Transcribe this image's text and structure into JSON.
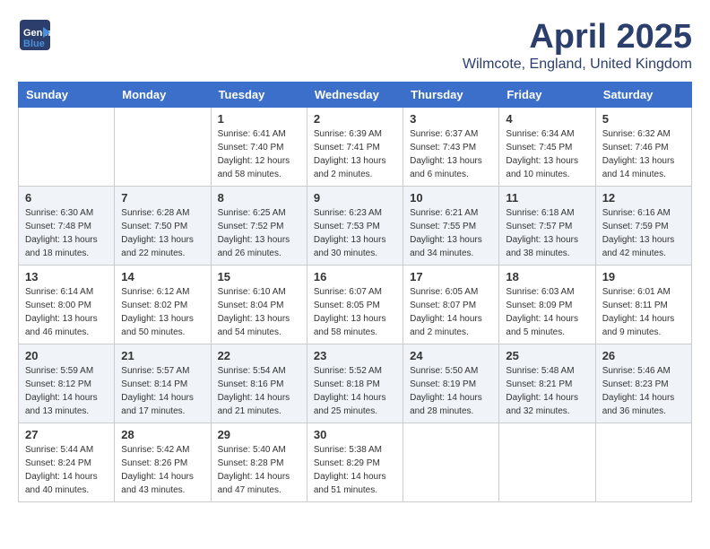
{
  "header": {
    "logo_general": "General",
    "logo_blue": "Blue",
    "month_title": "April 2025",
    "location": "Wilmcote, England, United Kingdom"
  },
  "days_of_week": [
    "Sunday",
    "Monday",
    "Tuesday",
    "Wednesday",
    "Thursday",
    "Friday",
    "Saturday"
  ],
  "weeks": [
    [
      {
        "day": "",
        "info": ""
      },
      {
        "day": "",
        "info": ""
      },
      {
        "day": "1",
        "info": "Sunrise: 6:41 AM\nSunset: 7:40 PM\nDaylight: 12 hours\nand 58 minutes."
      },
      {
        "day": "2",
        "info": "Sunrise: 6:39 AM\nSunset: 7:41 PM\nDaylight: 13 hours\nand 2 minutes."
      },
      {
        "day": "3",
        "info": "Sunrise: 6:37 AM\nSunset: 7:43 PM\nDaylight: 13 hours\nand 6 minutes."
      },
      {
        "day": "4",
        "info": "Sunrise: 6:34 AM\nSunset: 7:45 PM\nDaylight: 13 hours\nand 10 minutes."
      },
      {
        "day": "5",
        "info": "Sunrise: 6:32 AM\nSunset: 7:46 PM\nDaylight: 13 hours\nand 14 minutes."
      }
    ],
    [
      {
        "day": "6",
        "info": "Sunrise: 6:30 AM\nSunset: 7:48 PM\nDaylight: 13 hours\nand 18 minutes."
      },
      {
        "day": "7",
        "info": "Sunrise: 6:28 AM\nSunset: 7:50 PM\nDaylight: 13 hours\nand 22 minutes."
      },
      {
        "day": "8",
        "info": "Sunrise: 6:25 AM\nSunset: 7:52 PM\nDaylight: 13 hours\nand 26 minutes."
      },
      {
        "day": "9",
        "info": "Sunrise: 6:23 AM\nSunset: 7:53 PM\nDaylight: 13 hours\nand 30 minutes."
      },
      {
        "day": "10",
        "info": "Sunrise: 6:21 AM\nSunset: 7:55 PM\nDaylight: 13 hours\nand 34 minutes."
      },
      {
        "day": "11",
        "info": "Sunrise: 6:18 AM\nSunset: 7:57 PM\nDaylight: 13 hours\nand 38 minutes."
      },
      {
        "day": "12",
        "info": "Sunrise: 6:16 AM\nSunset: 7:59 PM\nDaylight: 13 hours\nand 42 minutes."
      }
    ],
    [
      {
        "day": "13",
        "info": "Sunrise: 6:14 AM\nSunset: 8:00 PM\nDaylight: 13 hours\nand 46 minutes."
      },
      {
        "day": "14",
        "info": "Sunrise: 6:12 AM\nSunset: 8:02 PM\nDaylight: 13 hours\nand 50 minutes."
      },
      {
        "day": "15",
        "info": "Sunrise: 6:10 AM\nSunset: 8:04 PM\nDaylight: 13 hours\nand 54 minutes."
      },
      {
        "day": "16",
        "info": "Sunrise: 6:07 AM\nSunset: 8:05 PM\nDaylight: 13 hours\nand 58 minutes."
      },
      {
        "day": "17",
        "info": "Sunrise: 6:05 AM\nSunset: 8:07 PM\nDaylight: 14 hours\nand 2 minutes."
      },
      {
        "day": "18",
        "info": "Sunrise: 6:03 AM\nSunset: 8:09 PM\nDaylight: 14 hours\nand 5 minutes."
      },
      {
        "day": "19",
        "info": "Sunrise: 6:01 AM\nSunset: 8:11 PM\nDaylight: 14 hours\nand 9 minutes."
      }
    ],
    [
      {
        "day": "20",
        "info": "Sunrise: 5:59 AM\nSunset: 8:12 PM\nDaylight: 14 hours\nand 13 minutes."
      },
      {
        "day": "21",
        "info": "Sunrise: 5:57 AM\nSunset: 8:14 PM\nDaylight: 14 hours\nand 17 minutes."
      },
      {
        "day": "22",
        "info": "Sunrise: 5:54 AM\nSunset: 8:16 PM\nDaylight: 14 hours\nand 21 minutes."
      },
      {
        "day": "23",
        "info": "Sunrise: 5:52 AM\nSunset: 8:18 PM\nDaylight: 14 hours\nand 25 minutes."
      },
      {
        "day": "24",
        "info": "Sunrise: 5:50 AM\nSunset: 8:19 PM\nDaylight: 14 hours\nand 28 minutes."
      },
      {
        "day": "25",
        "info": "Sunrise: 5:48 AM\nSunset: 8:21 PM\nDaylight: 14 hours\nand 32 minutes."
      },
      {
        "day": "26",
        "info": "Sunrise: 5:46 AM\nSunset: 8:23 PM\nDaylight: 14 hours\nand 36 minutes."
      }
    ],
    [
      {
        "day": "27",
        "info": "Sunrise: 5:44 AM\nSunset: 8:24 PM\nDaylight: 14 hours\nand 40 minutes."
      },
      {
        "day": "28",
        "info": "Sunrise: 5:42 AM\nSunset: 8:26 PM\nDaylight: 14 hours\nand 43 minutes."
      },
      {
        "day": "29",
        "info": "Sunrise: 5:40 AM\nSunset: 8:28 PM\nDaylight: 14 hours\nand 47 minutes."
      },
      {
        "day": "30",
        "info": "Sunrise: 5:38 AM\nSunset: 8:29 PM\nDaylight: 14 hours\nand 51 minutes."
      },
      {
        "day": "",
        "info": ""
      },
      {
        "day": "",
        "info": ""
      },
      {
        "day": "",
        "info": ""
      }
    ]
  ]
}
